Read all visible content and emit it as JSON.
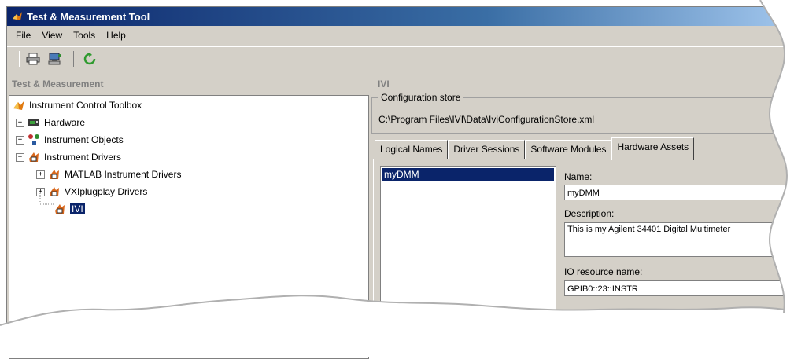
{
  "window": {
    "title": "Test & Measurement Tool"
  },
  "menu": [
    "File",
    "View",
    "Tools",
    "Help"
  ],
  "toolbar": {
    "icons": [
      "print-icon",
      "network-icon",
      "refresh-icon"
    ]
  },
  "left": {
    "header": "Test & Measurement",
    "tree": [
      {
        "label": "Instrument Control Toolbox",
        "icon": "matlab-logo-icon"
      },
      {
        "label": "Hardware",
        "icon": "hardware-icon",
        "expander": "+"
      },
      {
        "label": "Instrument Objects",
        "icon": "instrument-objects-icon",
        "expander": "+"
      },
      {
        "label": "Instrument Drivers",
        "icon": "driver-icon",
        "expander": "−"
      },
      {
        "label": "MATLAB Instrument Drivers",
        "icon": "driver-icon",
        "expander": "+"
      },
      {
        "label": "VXIplugplay Drivers",
        "icon": "driver-icon",
        "expander": "+"
      },
      {
        "label": "IVI",
        "icon": "ivi-icon"
      }
    ]
  },
  "right": {
    "header": "IVI",
    "config_title": "Configuration store",
    "config_path": "C:\\Program Files\\IVI\\Data\\IviConfigurationStore.xml",
    "tabs": [
      "Logical Names",
      "Driver Sessions",
      "Software Modules",
      "Hardware Assets"
    ],
    "active_tab": "Hardware Assets",
    "assets": [
      "myDMM"
    ],
    "name_label": "Name:",
    "name_value": "myDMM",
    "description_label": "Description:",
    "description_value": "This is my Agilent 34401 Digital Multimeter",
    "io_label": "IO resource name:",
    "io_value": "GPIB0::23::INSTR"
  },
  "colors": {
    "title_start": "#0a246a",
    "selection": "#0a246a",
    "face": "#d4d0c8"
  }
}
